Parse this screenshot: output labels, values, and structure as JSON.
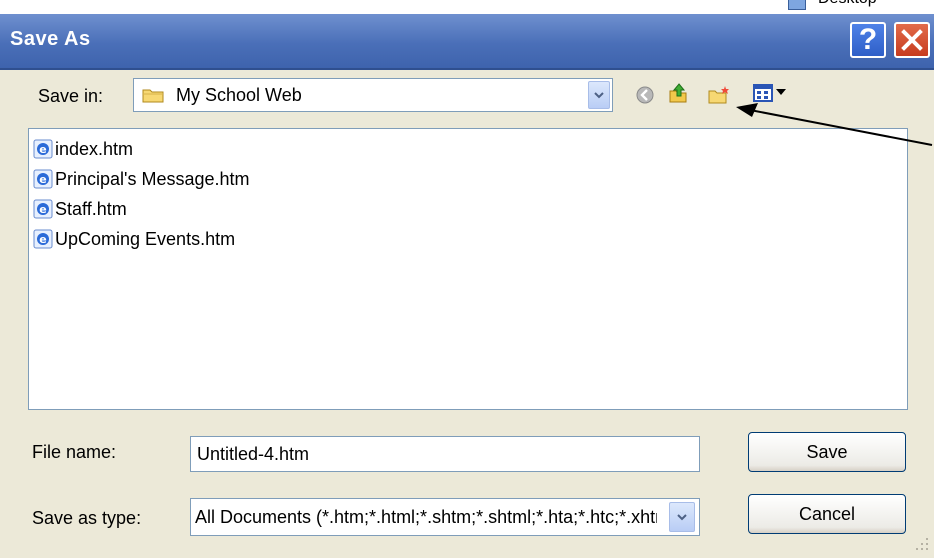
{
  "top_crop_text": "Desktop",
  "window": {
    "title": "Save As",
    "help_label": "?",
    "close_label": "✕"
  },
  "save_in": {
    "label": "Save in:",
    "value": "My School Web",
    "icon": "folder-icon"
  },
  "toolbar": {
    "icons": [
      "back-icon",
      "up-folder-icon",
      "new-folder-icon",
      "views-menu-icon"
    ]
  },
  "files": [
    {
      "name": "index.htm",
      "icon": "ie-html-icon"
    },
    {
      "name": "Principal's Message.htm",
      "icon": "ie-html-icon"
    },
    {
      "name": "Staff.htm",
      "icon": "ie-html-icon"
    },
    {
      "name": "UpComing Events.htm",
      "icon": "ie-html-icon"
    }
  ],
  "file_name": {
    "label": "File name:",
    "value": "Untitled-4.htm"
  },
  "save_as_type": {
    "label": "Save as type:",
    "value": "All Documents (*.htm;*.html;*.shtm;*.shtml;*.hta;*.htc;*.xhtml;*.stm;*.ssi;*.js;*.json;*.as;*.asc;*.asr;*.xml;*.xsd;*.xsl;*.xslt;*.xslt;*.wml;*.edml;*.php;*.php3;*.php4;*.php5;*.inc;*.asp;*.aspx;*.asa;*.asmx;*.ascx;*.ashx;*.asax;*.config;*.cs;*.vb;*.cfm;*.cfml;*.cfc;*.jsp;*.jst;*.css;*.tpl;*.lbi;*.dwt;*.txt)"
  },
  "buttons": {
    "save": "Save",
    "cancel": "Cancel"
  },
  "colors": {
    "titlebar": "#4a6fb8",
    "face": "#ece9d8",
    "field_border": "#7f9db9",
    "button_border": "#003c74"
  }
}
